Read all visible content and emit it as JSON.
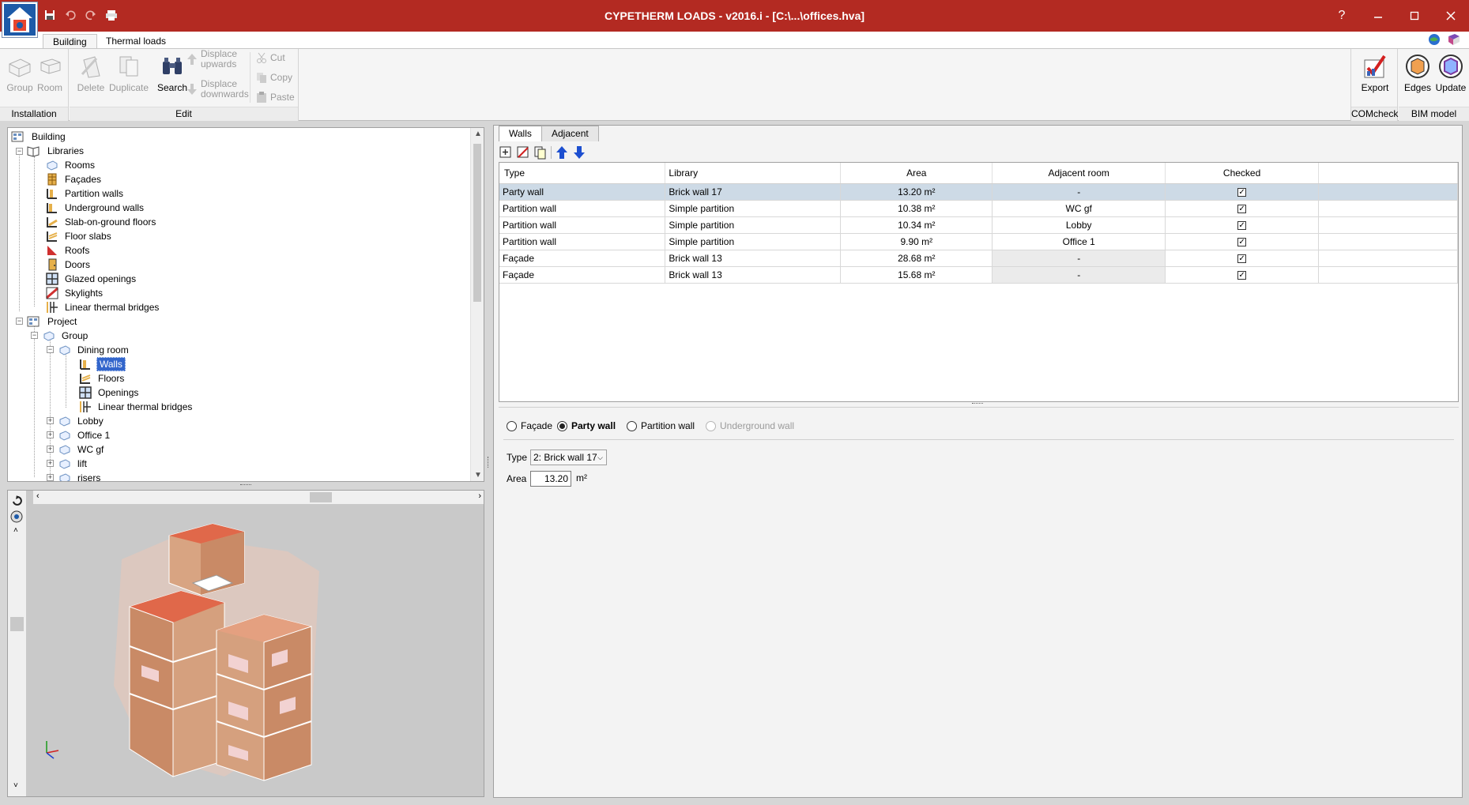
{
  "app": {
    "title": "CYPETHERM LOADS - v2016.i - [C:\\...\\offices.hva]"
  },
  "ribbon": {
    "tabs": [
      "Building",
      "Thermal loads"
    ],
    "installation": {
      "label": "Installation",
      "group": "Group",
      "room": "Room"
    },
    "edit": {
      "label": "Edit",
      "delete": "Delete",
      "duplicate": "Duplicate",
      "search": "Search",
      "displace_up_1": "Displace",
      "displace_up_2": "upwards",
      "displace_down_1": "Displace",
      "displace_down_2": "downwards",
      "cut": "Cut",
      "copy": "Copy",
      "paste": "Paste"
    },
    "comcheck": {
      "label": "COMcheck",
      "export": "Export"
    },
    "bim": {
      "label": "BIM model",
      "edges": "Edges",
      "update": "Update"
    }
  },
  "tree": {
    "building": "Building",
    "libraries": "Libraries",
    "lib_items": [
      "Rooms",
      "Façades",
      "Partition walls",
      "Underground walls",
      "Slab-on-ground floors",
      "Floor slabs",
      "Roofs",
      "Doors",
      "Glazed openings",
      "Skylights",
      "Linear thermal bridges"
    ],
    "project": "Project",
    "group": "Group",
    "dining_room": "Dining room",
    "dining_items": [
      "Walls",
      "Floors",
      "Openings",
      "Linear thermal bridges"
    ],
    "rooms": [
      "Lobby",
      "Office 1",
      "WC gf",
      "lift",
      "risers"
    ]
  },
  "panel": {
    "tabs": [
      "Walls",
      "Adjacent"
    ],
    "columns": [
      "Type",
      "Library",
      "Area",
      "Adjacent room",
      "Checked"
    ],
    "rows": [
      {
        "type": "Party wall",
        "library": "Brick wall 17",
        "area": "13.20 m²",
        "adjacent": "-",
        "checked": "✓"
      },
      {
        "type": "Partition wall",
        "library": "Simple partition",
        "area": "10.38 m²",
        "adjacent": "WC gf",
        "checked": "✓"
      },
      {
        "type": "Partition wall",
        "library": "Simple partition",
        "area": "10.34 m²",
        "adjacent": "Lobby",
        "checked": "✓"
      },
      {
        "type": "Partition wall",
        "library": "Simple partition",
        "area": "9.90 m²",
        "adjacent": "Office 1",
        "checked": "✓"
      },
      {
        "type": "Façade",
        "library": "Brick wall 13",
        "area": "28.68 m²",
        "adjacent": "-",
        "checked": "✓"
      },
      {
        "type": "Façade",
        "library": "Brick wall 13",
        "area": "15.68 m²",
        "adjacent": "-",
        "checked": "✓"
      }
    ],
    "wall_kinds": [
      "Façade",
      "Party wall",
      "Partition wall",
      "Underground wall"
    ],
    "selected_kind": "Party wall",
    "type_label": "Type",
    "type_value": "2: Brick wall 17",
    "area_label": "Area",
    "area_value": "13.20",
    "area_unit": "m²"
  },
  "colors": {
    "titlebar": "#b32a22",
    "selection": "#cddae6",
    "accent": "#3366cc"
  }
}
